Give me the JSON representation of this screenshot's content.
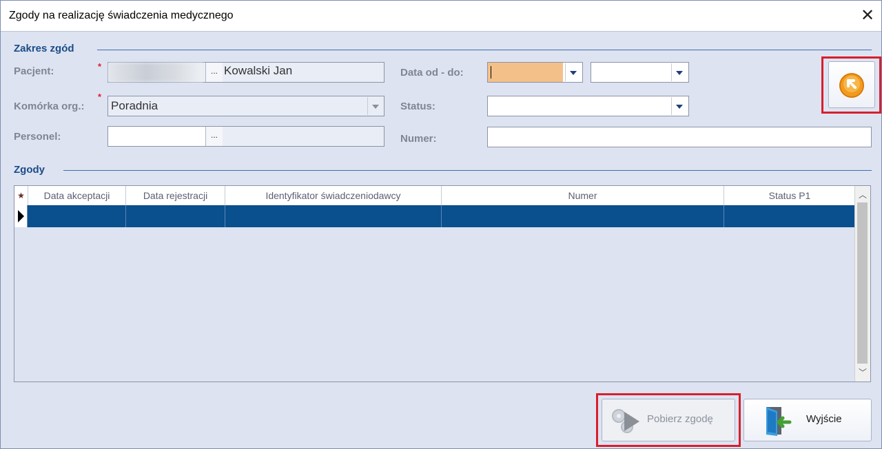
{
  "window": {
    "title": "Zgody na realizację świadczenia medycznego",
    "close_glyph": "✕"
  },
  "scope": {
    "group_title": "Zakres zgód",
    "patient_label": "Pacjent:",
    "patient_value": "Kowalski Jan",
    "unit_label": "Komórka org.:",
    "unit_value": "Poradnia",
    "staff_label": "Personel:",
    "staff_value": "",
    "date_label": "Data od - do:",
    "date_from": "",
    "date_to": "",
    "status_label": "Status:",
    "status_value": "",
    "number_label": "Numer:",
    "number_value": "",
    "ellipsis": "...",
    "required_mark": "*"
  },
  "consents": {
    "group_title": "Zgody",
    "columns": [
      "Data akceptacji",
      "Data rejestracji",
      "Identyfikator świadczeniodawcy",
      "Numer",
      "Status P1"
    ],
    "rows": []
  },
  "buttons": {
    "fetch_label": "Pobierz zgodę",
    "exit_label": "Wyjście"
  },
  "icons": {
    "search": "search-icon",
    "fetch": "gear-arrow-icon",
    "exit": "exit-door-icon"
  },
  "colors": {
    "background": "#dde3f1",
    "group_title": "#1b4c86",
    "selected_row": "#0a4f8e",
    "date_from_bg": "#f4c089",
    "highlight": "#d81e2d"
  }
}
